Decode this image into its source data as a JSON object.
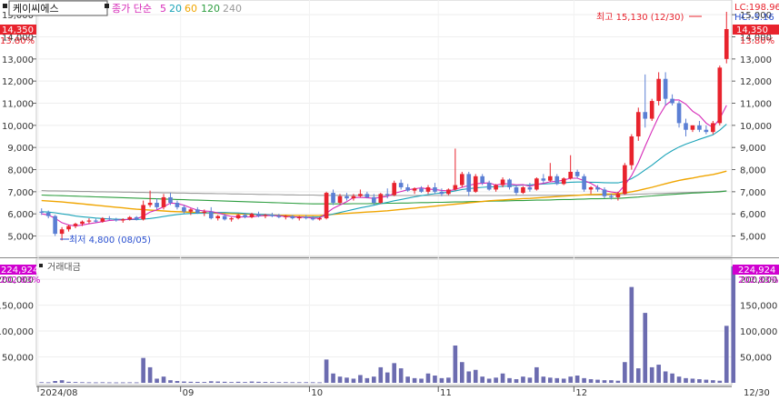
{
  "colors": {
    "up": "#e8232d",
    "down": "#5b7fd4",
    "ma5": "#d62ab8",
    "ma20": "#1aa3b8",
    "ma60": "#f0a500",
    "ma120": "#2e9e40",
    "ma240": "#9a9a9a",
    "volume": "#6c6cb0",
    "last_price_bg": "#e8232d",
    "volume_badge_bg": "#d000d0",
    "axis": "#333333"
  },
  "legend": {
    "stock_name": "케이씨에스",
    "ma_type": "종가 단순",
    "periods": [
      "5",
      "20",
      "60",
      "120",
      "240"
    ]
  },
  "price_panel": {
    "last_price": "14,350",
    "change_pct": "13.80%",
    "lc": "LC:198.96",
    "hc": "HC:-5.16",
    "high_annotation": "최고 15,130 (12/30)",
    "low_annotation": "최저 4,800 (08/05)"
  },
  "volume_panel": {
    "title": "거래대금",
    "last_value": "224,924",
    "pct": "202.83%"
  },
  "chart_data": [
    {
      "type": "candlestick",
      "title": "",
      "ylim": [
        4200,
        15500
      ],
      "yticks": [
        "5,000",
        "6,000",
        "7,000",
        "8,000",
        "9,000",
        "10,000",
        "11,000",
        "12,000",
        "13,000",
        "14,000",
        "15,000"
      ],
      "ytick_values": [
        5000,
        6000,
        7000,
        8000,
        9000,
        10000,
        11000,
        12000,
        13000,
        14000,
        15000
      ],
      "xtick_labels": [
        "2024/08",
        "09",
        "10",
        "11",
        "12",
        "12/30"
      ],
      "xtick_index": [
        0,
        21,
        40,
        59,
        79,
        103
      ],
      "candles": [
        [
          6100,
          6250,
          5950,
          6050
        ],
        [
          6050,
          6150,
          5800,
          5900
        ],
        [
          5900,
          5950,
          5000,
          5100
        ],
        [
          5100,
          5400,
          4800,
          5300
        ],
        [
          5300,
          5500,
          5200,
          5450
        ],
        [
          5450,
          5600,
          5350,
          5550
        ],
        [
          5550,
          5700,
          5450,
          5650
        ],
        [
          5650,
          5800,
          5550,
          5700
        ],
        [
          5700,
          5780,
          5600,
          5650
        ],
        [
          5650,
          5850,
          5600,
          5800
        ],
        [
          5800,
          5900,
          5700,
          5750
        ],
        [
          5750,
          5820,
          5650,
          5700
        ],
        [
          5700,
          5800,
          5600,
          5750
        ],
        [
          5750,
          5900,
          5700,
          5850
        ],
        [
          5850,
          5900,
          5700,
          5750
        ],
        [
          5750,
          6600,
          5700,
          6400
        ],
        [
          6400,
          7050,
          6300,
          6500
        ],
        [
          6500,
          6700,
          6200,
          6300
        ],
        [
          6300,
          6900,
          6200,
          6750
        ],
        [
          6750,
          6950,
          6400,
          6500
        ],
        [
          6500,
          6600,
          6200,
          6300
        ],
        [
          6300,
          6400,
          6000,
          6100
        ],
        [
          6100,
          6250,
          5950,
          6200
        ],
        [
          6200,
          6300,
          6000,
          6050
        ],
        [
          6050,
          6200,
          5900,
          6100
        ],
        [
          6100,
          6300,
          5750,
          5800
        ],
        [
          5800,
          5950,
          5700,
          5900
        ],
        [
          5900,
          6000,
          5700,
          5750
        ],
        [
          5750,
          5850,
          5650,
          5800
        ],
        [
          5800,
          6000,
          5750,
          5950
        ],
        [
          5950,
          6050,
          5800,
          5850
        ],
        [
          5850,
          6050,
          5800,
          6000
        ],
        [
          6000,
          6100,
          5850,
          5900
        ],
        [
          5900,
          6000,
          5800,
          5950
        ],
        [
          5950,
          6050,
          5850,
          5900
        ],
        [
          5900,
          6000,
          5800,
          5850
        ],
        [
          5850,
          5950,
          5750,
          5900
        ],
        [
          5900,
          5950,
          5750,
          5800
        ],
        [
          5800,
          5900,
          5700,
          5850
        ],
        [
          5850,
          5950,
          5750,
          5800
        ],
        [
          5800,
          5900,
          5700,
          5750
        ],
        [
          5750,
          5850,
          5700,
          5800
        ],
        [
          5800,
          7000,
          5750,
          6950
        ],
        [
          6950,
          7100,
          6400,
          6500
        ],
        [
          6500,
          6900,
          6450,
          6800
        ],
        [
          6800,
          6950,
          6600,
          6700
        ],
        [
          6700,
          6900,
          6600,
          6800
        ],
        [
          6800,
          7100,
          6750,
          6900
        ],
        [
          6900,
          7000,
          6700,
          6750
        ],
        [
          6750,
          6900,
          6400,
          6500
        ],
        [
          6500,
          6950,
          6450,
          6900
        ],
        [
          6900,
          7150,
          6700,
          6850
        ],
        [
          6850,
          7500,
          6800,
          7400
        ],
        [
          7400,
          7550,
          7100,
          7200
        ],
        [
          7200,
          7350,
          7000,
          7050
        ],
        [
          7050,
          7200,
          6900,
          7150
        ],
        [
          7150,
          7250,
          6950,
          7000
        ],
        [
          7000,
          7300,
          6900,
          7200
        ],
        [
          7200,
          7400,
          6900,
          7000
        ],
        [
          7000,
          7150,
          6800,
          6900
        ],
        [
          6900,
          7150,
          6850,
          7100
        ],
        [
          7100,
          8950,
          7050,
          7300
        ],
        [
          7300,
          7900,
          7200,
          7800
        ],
        [
          7800,
          7900,
          6800,
          7000
        ],
        [
          7000,
          7800,
          6950,
          7700
        ],
        [
          7700,
          7800,
          7300,
          7400
        ],
        [
          7400,
          7500,
          7050,
          7100
        ],
        [
          7100,
          7350,
          7000,
          7300
        ],
        [
          7300,
          7650,
          7200,
          7550
        ],
        [
          7550,
          7600,
          7100,
          7200
        ],
        [
          7200,
          7300,
          6850,
          6950
        ],
        [
          6950,
          7250,
          6900,
          7200
        ],
        [
          7200,
          7400,
          7000,
          7100
        ],
        [
          7100,
          7650,
          7050,
          7600
        ],
        [
          7600,
          7800,
          7400,
          7500
        ],
        [
          7500,
          8300,
          7450,
          7700
        ],
        [
          7700,
          7800,
          7300,
          7350
        ],
        [
          7350,
          7650,
          7300,
          7600
        ],
        [
          7600,
          8650,
          7550,
          7900
        ],
        [
          7900,
          8000,
          7600,
          7700
        ],
        [
          7700,
          7800,
          7000,
          7100
        ],
        [
          7100,
          7250,
          6900,
          7200
        ],
        [
          7200,
          7300,
          7000,
          7100
        ],
        [
          7100,
          7200,
          6700,
          6800
        ],
        [
          6800,
          6900,
          6650,
          6750
        ],
        [
          6750,
          7000,
          6600,
          6900
        ],
        [
          6900,
          8300,
          6850,
          8200
        ],
        [
          8200,
          9600,
          8000,
          9500
        ],
        [
          9500,
          10800,
          9300,
          10600
        ],
        [
          10600,
          12300,
          9900,
          10300
        ],
        [
          10300,
          11200,
          10200,
          11100
        ],
        [
          11100,
          12400,
          10900,
          12100
        ],
        [
          12100,
          12400,
          10900,
          11200
        ],
        [
          11200,
          11400,
          10900,
          11000
        ],
        [
          11000,
          11100,
          9900,
          10100
        ],
        [
          10100,
          10300,
          9500,
          9800
        ],
        [
          9800,
          10000,
          9700,
          10000
        ],
        [
          10000,
          10200,
          9700,
          9800
        ],
        [
          9800,
          10000,
          9600,
          9700
        ],
        [
          9700,
          10200,
          9600,
          10100
        ],
        [
          10100,
          12700,
          10000,
          12610
        ],
        [
          13000,
          15130,
          12800,
          14350
        ]
      ],
      "ma5": [
        6000,
        5950,
        5800,
        5600,
        5500,
        5450,
        5500,
        5550,
        5600,
        5650,
        5700,
        5720,
        5730,
        5760,
        5770,
        5900,
        6080,
        6180,
        6320,
        6490,
        6470,
        6390,
        6270,
        6170,
        6130,
        6110,
        6040,
        5960,
        5880,
        5860,
        5860,
        5870,
        5900,
        5930,
        5920,
        5910,
        5890,
        5860,
        5850,
        5840,
        5810,
        5800,
        6030,
        6250,
        6400,
        6550,
        6740,
        6740,
        6730,
        6700,
        6750,
        6790,
        6930,
        7010,
        7090,
        7130,
        7180,
        7120,
        7100,
        7060,
        7040,
        7100,
        7200,
        7280,
        7360,
        7380,
        7400,
        7300,
        7360,
        7350,
        7310,
        7320,
        7250,
        7330,
        7380,
        7450,
        7470,
        7530,
        7610,
        7610,
        7500,
        7380,
        7200,
        7050,
        6990,
        6950,
        7300,
        7730,
        8330,
        9050,
        9740,
        10400,
        10900,
        11150,
        11150,
        10960,
        10640,
        10440,
        10100,
        9900,
        10300,
        10900
      ],
      "ma20": [
        6100,
        6080,
        6050,
        6000,
        5960,
        5900,
        5870,
        5840,
        5810,
        5790,
        5770,
        5760,
        5750,
        5740,
        5740,
        5760,
        5790,
        5830,
        5880,
        5930,
        5970,
        6000,
        6020,
        6030,
        6040,
        6050,
        6060,
        6060,
        6050,
        6040,
        6020,
        6000,
        5980,
        5970,
        5950,
        5920,
        5890,
        5870,
        5860,
        5850,
        5850,
        5860,
        5920,
        5990,
        6060,
        6130,
        6200,
        6270,
        6330,
        6390,
        6460,
        6520,
        6590,
        6650,
        6710,
        6770,
        6820,
        6870,
        6910,
        6940,
        6980,
        7040,
        7100,
        7140,
        7170,
        7200,
        7220,
        7220,
        7240,
        7260,
        7280,
        7300,
        7310,
        7330,
        7350,
        7370,
        7390,
        7410,
        7430,
        7440,
        7440,
        7430,
        7420,
        7410,
        7400,
        7400,
        7470,
        7590,
        7770,
        7990,
        8200,
        8440,
        8670,
        8860,
        9020,
        9150,
        9260,
        9370,
        9470,
        9570,
        9780,
        10050
      ],
      "ma60": [
        6600,
        6580,
        6560,
        6540,
        6510,
        6480,
        6450,
        6420,
        6390,
        6360,
        6330,
        6300,
        6270,
        6240,
        6210,
        6190,
        6170,
        6150,
        6130,
        6110,
        6100,
        6090,
        6070,
        6060,
        6050,
        6040,
        6030,
        6020,
        6010,
        6000,
        5990,
        5980,
        5970,
        5960,
        5950,
        5940,
        5940,
        5930,
        5930,
        5920,
        5920,
        5930,
        5950,
        5980,
        6000,
        6020,
        6040,
        6060,
        6080,
        6100,
        6120,
        6140,
        6170,
        6200,
        6230,
        6260,
        6290,
        6320,
        6350,
        6380,
        6410,
        6440,
        6470,
        6500,
        6530,
        6560,
        6590,
        6610,
        6630,
        6650,
        6670,
        6690,
        6700,
        6720,
        6740,
        6760,
        6780,
        6800,
        6820,
        6840,
        6860,
        6870,
        6880,
        6890,
        6900,
        6910,
        6950,
        7000,
        7060,
        7130,
        7200,
        7280,
        7360,
        7440,
        7510,
        7570,
        7620,
        7680,
        7730,
        7780,
        7850,
        7930
      ],
      "ma120": [
        6850,
        6840,
        6830,
        6820,
        6810,
        6800,
        6790,
        6780,
        6770,
        6760,
        6750,
        6740,
        6730,
        6720,
        6710,
        6700,
        6690,
        6680,
        6670,
        6660,
        6650,
        6640,
        6630,
        6620,
        6610,
        6600,
        6590,
        6580,
        6570,
        6560,
        6550,
        6540,
        6530,
        6520,
        6510,
        6500,
        6490,
        6480,
        6470,
        6460,
        6450,
        6450,
        6450,
        6450,
        6450,
        6450,
        6460,
        6460,
        6460,
        6470,
        6470,
        6480,
        6480,
        6490,
        6490,
        6500,
        6510,
        6510,
        6520,
        6520,
        6530,
        6540,
        6540,
        6550,
        6560,
        6560,
        6570,
        6580,
        6580,
        6590,
        6600,
        6600,
        6610,
        6620,
        6620,
        6630,
        6640,
        6650,
        6650,
        6660,
        6670,
        6680,
        6680,
        6690,
        6700,
        6700,
        6720,
        6740,
        6760,
        6790,
        6810,
        6840,
        6860,
        6880,
        6900,
        6920,
        6940,
        6950,
        6970,
        6980,
        7000,
        7030
      ],
      "ma240": [
        7050,
        7040,
        7040,
        7030,
        7030,
        7020,
        7010,
        7010,
        7000,
        7000,
        6990,
        6990,
        6980,
        6980,
        6970,
        6970,
        6960,
        6960,
        6950,
        6950,
        6940,
        6940,
        6930,
        6930,
        6920,
        6920,
        6910,
        6910,
        6900,
        6900,
        6890,
        6890,
        6880,
        6880,
        6870,
        6870,
        6860,
        6860,
        6850,
        6850,
        6850,
        6840,
        6840,
        6840,
        6840,
        6840,
        6840,
        6840,
        6830,
        6830,
        6830,
        6830,
        6830,
        6830,
        6830,
        6830,
        6830,
        6830,
        6830,
        6830,
        6830,
        6830,
        6830,
        6830,
        6830,
        6830,
        6830,
        6830,
        6830,
        6840,
        6840,
        6840,
        6840,
        6840,
        6840,
        6840,
        6840,
        6840,
        6850,
        6850,
        6850,
        6850,
        6850,
        6860,
        6860,
        6860,
        6870,
        6880,
        6890,
        6900,
        6910,
        6920,
        6930,
        6940,
        6950,
        6960,
        6970,
        6980,
        6990,
        7000,
        7020,
        7040
      ]
    },
    {
      "type": "bar",
      "title": "거래대금",
      "ylim": [
        0,
        230000
      ],
      "yticks": [
        "50,000",
        "100,000",
        "150,000",
        "200,000"
      ],
      "ytick_values": [
        50000,
        100000,
        150000,
        200000
      ],
      "values": [
        1200,
        1000,
        3500,
        5000,
        2000,
        1500,
        1200,
        1000,
        900,
        1100,
        900,
        800,
        900,
        1000,
        900,
        48000,
        30000,
        8000,
        12000,
        5000,
        3500,
        2500,
        2000,
        1800,
        1600,
        3000,
        2500,
        2000,
        1500,
        2000,
        1500,
        2500,
        2000,
        1600,
        1500,
        1400,
        1300,
        1200,
        1200,
        1200,
        1100,
        1000,
        45000,
        18000,
        12000,
        10000,
        8000,
        15000,
        9000,
        12000,
        30000,
        20000,
        38000,
        28000,
        12000,
        9000,
        8000,
        18000,
        14000,
        9000,
        10000,
        72000,
        40000,
        22000,
        25000,
        12000,
        8000,
        10000,
        18000,
        9000,
        7000,
        12000,
        10000,
        30000,
        12000,
        10000,
        9000,
        8000,
        12000,
        14000,
        9000,
        7000,
        6000,
        5000,
        5000,
        4000,
        40000,
        185000,
        28000,
        135000,
        30000,
        35000,
        22000,
        18000,
        12000,
        9000,
        8000,
        7000,
        6000,
        5000,
        4000,
        110000,
        224924
      ]
    }
  ]
}
